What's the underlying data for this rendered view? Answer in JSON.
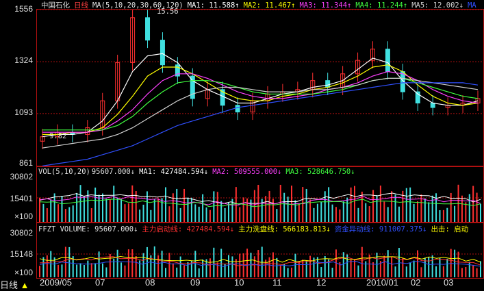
{
  "stock": {
    "name": "中国石化",
    "period": "日线"
  },
  "price_header": {
    "ma_params": "MA(5,10,20,30,60,120)",
    "ma1": "MA1: 11.588↑",
    "ma2": "MA2: 11.467↑",
    "ma3": "MA3: 11.344↑",
    "ma4": "MA4: 11.244↑",
    "ma5": "MA5: 12.002↓",
    "ma6": "MA"
  },
  "vol_header": {
    "params": "VOL(5,10,20)",
    "value": "95607.000↓",
    "ma1": "MA1: 427484.594↓",
    "ma2": "MA2: 509555.000↓",
    "ma3": "MA3: 528646.750↓"
  },
  "ffzt_header": {
    "name": "FFZT VOLUME: 95607.000↓",
    "main_start": "主力启动线: 427484.594↓",
    "main_wash": "主力洗盘线: 566183.813↓",
    "fund_flow": "资金异动线: 911007.375↓",
    "exit": "出击: 启动"
  },
  "price_axis": [
    "1556",
    "1324",
    "1093",
    "861"
  ],
  "vol_axis": [
    "30802",
    "15401",
    "×100"
  ],
  "ffzt_axis": [
    "30802",
    "15148",
    "×100"
  ],
  "annotations": {
    "high": "15.56",
    "low": "9.82"
  },
  "bottom_bar": {
    "period_button": "日线"
  },
  "x_labels": [
    "2009/05",
    "07",
    "08",
    "09",
    "10",
    "11",
    "12",
    "2010/01",
    "02",
    "03"
  ],
  "colors": {
    "up": "#ff3030",
    "down": "#40e0e0",
    "ma5": "#ffffff",
    "ma10": "#ffff00",
    "ma20": "#ff40ff",
    "ma30": "#40ff40",
    "ma60": "#d0d0d0",
    "ma120": "#3050ff",
    "grid": "#b01010"
  },
  "chart_data": {
    "type": "candlestick",
    "x": [
      "2009/05",
      "07",
      "08",
      "09",
      "10",
      "11",
      "12",
      "2010/01",
      "02",
      "03"
    ],
    "close": [
      9.9,
      10.1,
      10.0,
      10.3,
      11.5,
      13.2,
      15.2,
      14.2,
      13.1,
      12.6,
      11.6,
      12.0,
      11.3,
      11.0,
      11.5,
      11.8,
      11.9,
      12.0,
      12.4,
      12.1,
      12.7,
      13.3,
      13.8,
      12.8,
      11.9,
      11.4,
      11.2,
      11.3,
      11.4,
      11.6
    ],
    "moving_averages": {
      "MA1": [
        9.9,
        10.0,
        10.0,
        10.1,
        10.6,
        11.5,
        12.8,
        13.5,
        13.6,
        13.2,
        12.4,
        12.0,
        11.7,
        11.4,
        11.4,
        11.6,
        11.8,
        11.9,
        12.1,
        12.2,
        12.4,
        12.9,
        13.4,
        13.2,
        12.4,
        11.8,
        11.4,
        11.3,
        11.3,
        11.5
      ],
      "MA2": [
        10.0,
        10.0,
        10.1,
        10.1,
        10.3,
        10.9,
        11.7,
        12.6,
        13.0,
        13.0,
        12.7,
        12.3,
        11.9,
        11.6,
        11.5,
        11.5,
        11.7,
        11.8,
        12.0,
        12.1,
        12.3,
        12.6,
        13.0,
        13.1,
        12.8,
        12.2,
        11.7,
        11.4,
        11.3,
        11.4
      ],
      "MA3": [
        10.1,
        10.1,
        10.1,
        10.1,
        10.2,
        10.6,
        11.1,
        11.8,
        12.4,
        12.7,
        12.7,
        12.5,
        12.2,
        11.9,
        11.7,
        11.6,
        11.6,
        11.7,
        11.8,
        12.0,
        12.1,
        12.3,
        12.6,
        12.8,
        12.7,
        12.4,
        12.0,
        11.7,
        11.5,
        11.4
      ],
      "MA4": [
        10.2,
        10.2,
        10.2,
        10.2,
        10.2,
        10.4,
        10.8,
        11.4,
        11.9,
        12.3,
        12.4,
        12.4,
        12.3,
        12.1,
        11.9,
        11.8,
        11.8,
        11.8,
        11.8,
        11.9,
        12.0,
        12.2,
        12.4,
        12.5,
        12.5,
        12.3,
        12.1,
        11.9,
        11.7,
        11.6
      ],
      "MA5": [
        9.4,
        9.5,
        9.6,
        9.7,
        9.8,
        10.0,
        10.3,
        10.7,
        11.1,
        11.5,
        11.8,
        12.0,
        12.1,
        12.1,
        12.0,
        11.9,
        11.9,
        11.9,
        12.0,
        12.0,
        12.1,
        12.2,
        12.4,
        12.5,
        12.5,
        12.4,
        12.3,
        12.2,
        12.1,
        12.0
      ],
      "MA6": [
        8.6,
        8.7,
        8.8,
        8.9,
        9.1,
        9.3,
        9.5,
        9.8,
        10.1,
        10.4,
        10.6,
        10.8,
        11.0,
        11.2,
        11.3,
        11.4,
        11.5,
        11.6,
        11.7,
        11.8,
        11.9,
        12.0,
        12.1,
        12.2,
        12.3,
        12.3,
        12.3,
        12.3,
        12.3,
        12.2
      ]
    },
    "price_ylim": [
      8.61,
      15.56
    ],
    "volume_ylim": [
      0,
      30802
    ],
    "grid": true
  }
}
